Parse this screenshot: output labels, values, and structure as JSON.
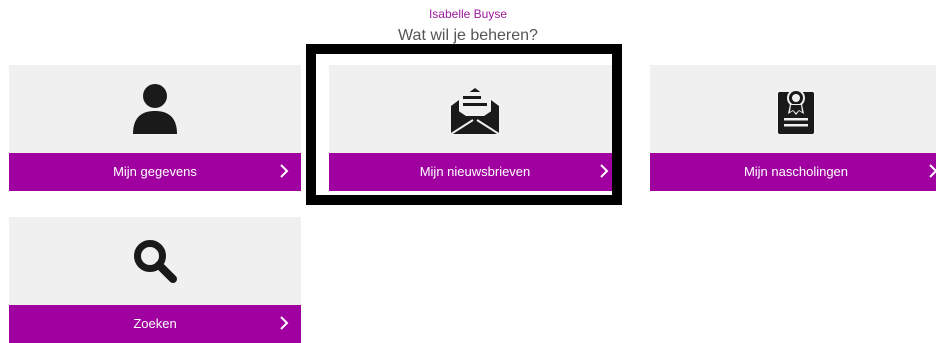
{
  "header": {
    "user_name": "Isabelle Buyse",
    "prompt": "Wat wil je beheren?"
  },
  "tiles": [
    {
      "label": "Mijn gegevens",
      "icon": "person-icon"
    },
    {
      "label": "Mijn nieuwsbrieven",
      "icon": "envelope-open-icon"
    },
    {
      "label": "Mijn nascholingen",
      "icon": "certificate-icon"
    },
    {
      "label": "Zoeken",
      "icon": "search-icon"
    }
  ],
  "colors": {
    "accent": "#a000a0",
    "tile_background": "#f0f0f0",
    "highlight_border": "#000000"
  }
}
